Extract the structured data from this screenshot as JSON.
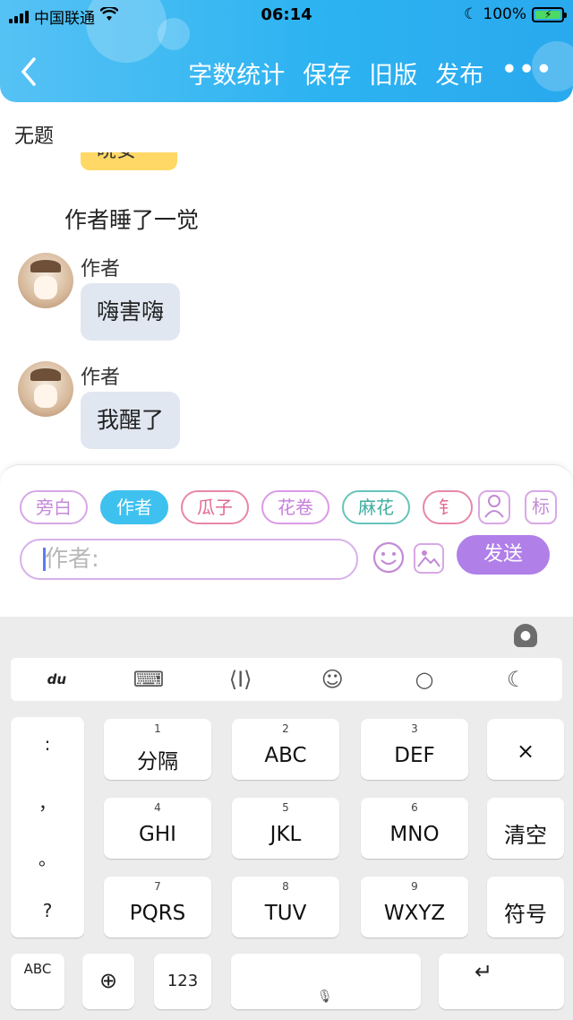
{
  "status_bar": {
    "carrier": "中国联通",
    "time": "06:14",
    "battery": "100%"
  },
  "nav": {
    "actions": [
      "字数统计",
      "保存",
      "旧版",
      "发布"
    ],
    "more": "•••"
  },
  "document": {
    "title": "无题"
  },
  "chat": {
    "partial_bubble_text": "晓安",
    "narration": "作者睡了一觉",
    "messages": [
      {
        "name": "作者",
        "text": "嗨害嗨"
      },
      {
        "name": "作者",
        "text": "我醒了"
      }
    ]
  },
  "composer": {
    "roles": [
      {
        "label": "旁白",
        "color": "#d7a7e6",
        "text_color": "#c58ad9"
      },
      {
        "label": "作者",
        "color": "#3fc1ef",
        "text_color": "#ffffff"
      },
      {
        "label": "瓜子",
        "color": "#e887a9",
        "text_color": "#e06a95"
      },
      {
        "label": "花卷",
        "color": "#d99be6",
        "text_color": "#c77edd"
      },
      {
        "label": "麻花",
        "color": "#66c4b8",
        "text_color": "#3fae9f"
      },
      {
        "label": "钅",
        "color": "#e887a9",
        "text_color": "#e06a95"
      }
    ],
    "label_icon": "标",
    "input_placeholder": "作者:",
    "send_label": "发送"
  },
  "keyboard": {
    "punctuation": [
      ":",
      "，",
      "。",
      "?"
    ],
    "keys": [
      {
        "num": "1",
        "label": "分隔"
      },
      {
        "num": "2",
        "label": "ABC"
      },
      {
        "num": "3",
        "label": "DEF"
      },
      {
        "num": "4",
        "label": "GHI"
      },
      {
        "num": "5",
        "label": "JKL"
      },
      {
        "num": "6",
        "label": "MNO"
      },
      {
        "num": "7",
        "label": "PQRS"
      },
      {
        "num": "8",
        "label": "TUV"
      },
      {
        "num": "9",
        "label": "WXYZ"
      }
    ],
    "delete_label": "×",
    "clear_label": "清空",
    "symbol_label": "符号",
    "abc_label": "ABC",
    "num_label": "123",
    "enter_label": "↵",
    "toolbar_logo": "du"
  },
  "colors": {
    "header": "#2db3f1",
    "send": "#b07fe8",
    "active_role": "#3fc1ef"
  }
}
